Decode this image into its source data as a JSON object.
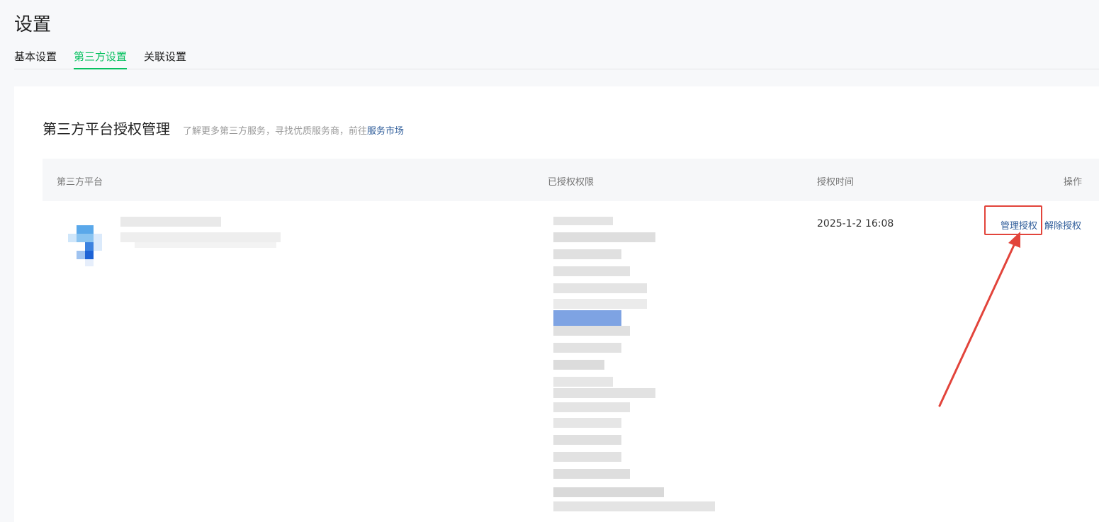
{
  "page": {
    "title": "设置"
  },
  "tabs": [
    {
      "label": "基本设置",
      "active": false
    },
    {
      "label": "第三方设置",
      "active": true
    },
    {
      "label": "关联设置",
      "active": false
    }
  ],
  "section": {
    "title": "第三方平台授权管理",
    "hint": "了解更多第三方服务，寻找优质服务商，前往",
    "link": "服务市场"
  },
  "table": {
    "columns": [
      "第三方平台",
      "已授权权限",
      "授权时间",
      "操作"
    ],
    "rows": [
      {
        "auth_time": "2025-1-2 16:08",
        "actions": {
          "manage": "管理授权",
          "revoke": "解除授权"
        }
      }
    ]
  },
  "colors": {
    "accent": "#07c160",
    "link": "#2f5d9a",
    "annotation": "#e2443b"
  }
}
